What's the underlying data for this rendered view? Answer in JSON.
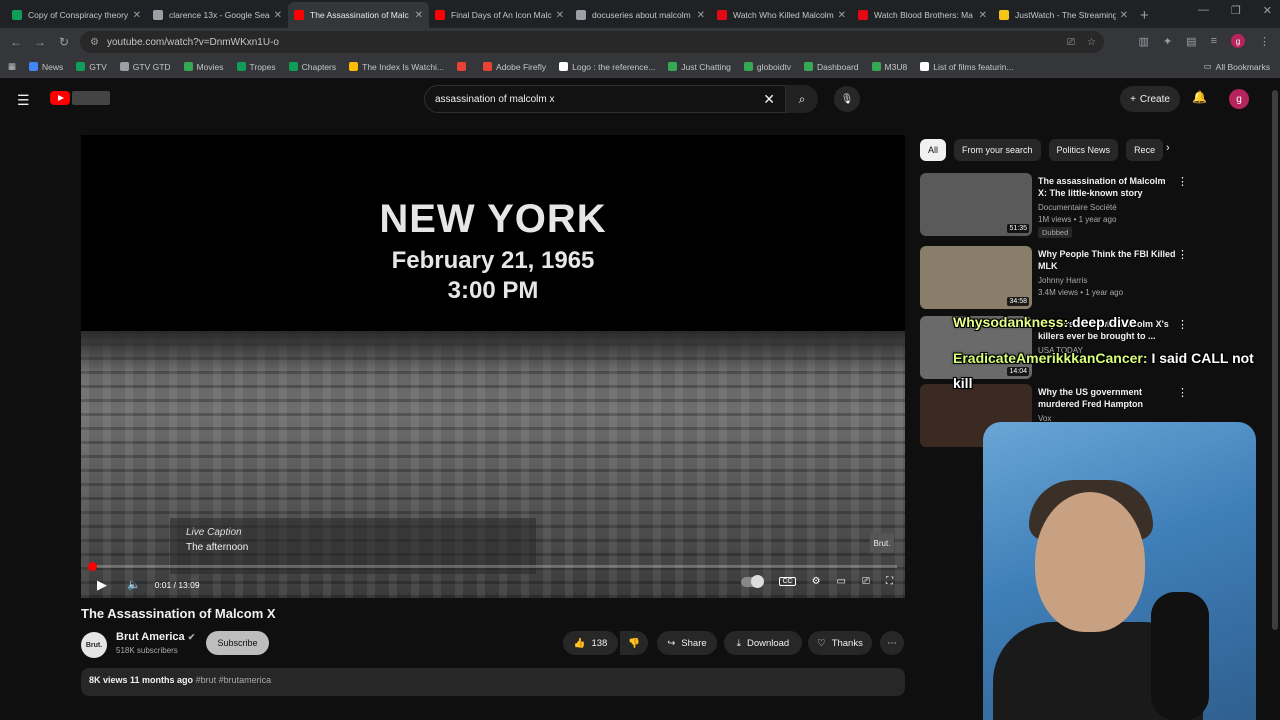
{
  "tabs": [
    {
      "title": "Copy of Conspiracy theory",
      "color": "#0f9d58"
    },
    {
      "title": "clarence 13x - Google Sea",
      "color": "#9aa0a6"
    },
    {
      "title": "The Assassination of Malc",
      "color": "#ff0000"
    },
    {
      "title": "Final Days of An Icon Malc",
      "color": "#ff0000"
    },
    {
      "title": "docuseries about malcolm",
      "color": "#9aa0a6"
    },
    {
      "title": "Watch Who Killed Malcolm",
      "color": "#e50914"
    },
    {
      "title": "Watch Blood Brothers: Ma",
      "color": "#e50914"
    },
    {
      "title": "JustWatch - The Streaming",
      "color": "#f5c518"
    }
  ],
  "url": "youtube.com/watch?v=DnmWKxn1U-o",
  "bookmarks": [
    "News",
    "GTV",
    "GTV GTD",
    "Movies",
    "Tropes",
    "Chapters",
    "The Index Is Watchi...",
    "",
    "Adobe Firefly",
    "Logo : the reference...",
    "Just Chatting",
    "globoidtv",
    "Dashboard",
    "M3U8",
    "List of films featurin..."
  ],
  "all_bookmarks": "All Bookmarks",
  "search": {
    "value": "assassination of malcolm x"
  },
  "create_label": "Create",
  "user_initial": "g",
  "video": {
    "overlay_city": "NEW YORK",
    "overlay_date": "February 21, 1965",
    "overlay_time": "3:00 PM",
    "caption_label": "Live Caption",
    "caption_text": "The afternoon",
    "watermark": "Brut.",
    "time": "0:01 / 13:09",
    "progress": 0.002
  },
  "title": "The Assassination of Malcom X",
  "channel": {
    "avatar": "Brut.",
    "name": "Brut America",
    "subs": "518K subscribers",
    "subscribe": "Subscribe"
  },
  "actions": {
    "likes": "138",
    "share": "Share",
    "download": "Download",
    "thanks": "Thanks"
  },
  "description": {
    "views": "8K views  11 months ago",
    "tags": "#brut #brutamerica"
  },
  "chips": [
    "All",
    "From your search",
    "Politics News",
    "Rece"
  ],
  "recommendations": [
    {
      "title": "The assassination of Malcolm X: The little-known story",
      "channel": "Documentaire Société",
      "meta": "1M views • 1 year ago",
      "badge": "Dubbed",
      "duration": "51:35",
      "thumb": "#5a5a5a"
    },
    {
      "title": "Why People Think the FBI Killed MLK",
      "channel": "Johnny Harris",
      "meta": "3.4M views • 1 year ago",
      "duration": "34:58",
      "thumb": "#8a7d6a"
    },
    {
      "title": "60 years later, will Malcolm X's killers ever be brought to ...",
      "channel": "USA TODAY",
      "meta": "",
      "duration": "14:04",
      "thumb": "#6a6a6a"
    },
    {
      "title": "Why the US government murdered Fred Hampton",
      "channel": "Vox",
      "meta": "",
      "duration": "18:12",
      "thumb": "#3a2a22"
    }
  ],
  "chat": [
    {
      "user": "Whysodankness:",
      "text": "deep dive"
    },
    {
      "user": "EradicateAmerikkkanCancer:",
      "text": "I said CALL not kill"
    }
  ]
}
